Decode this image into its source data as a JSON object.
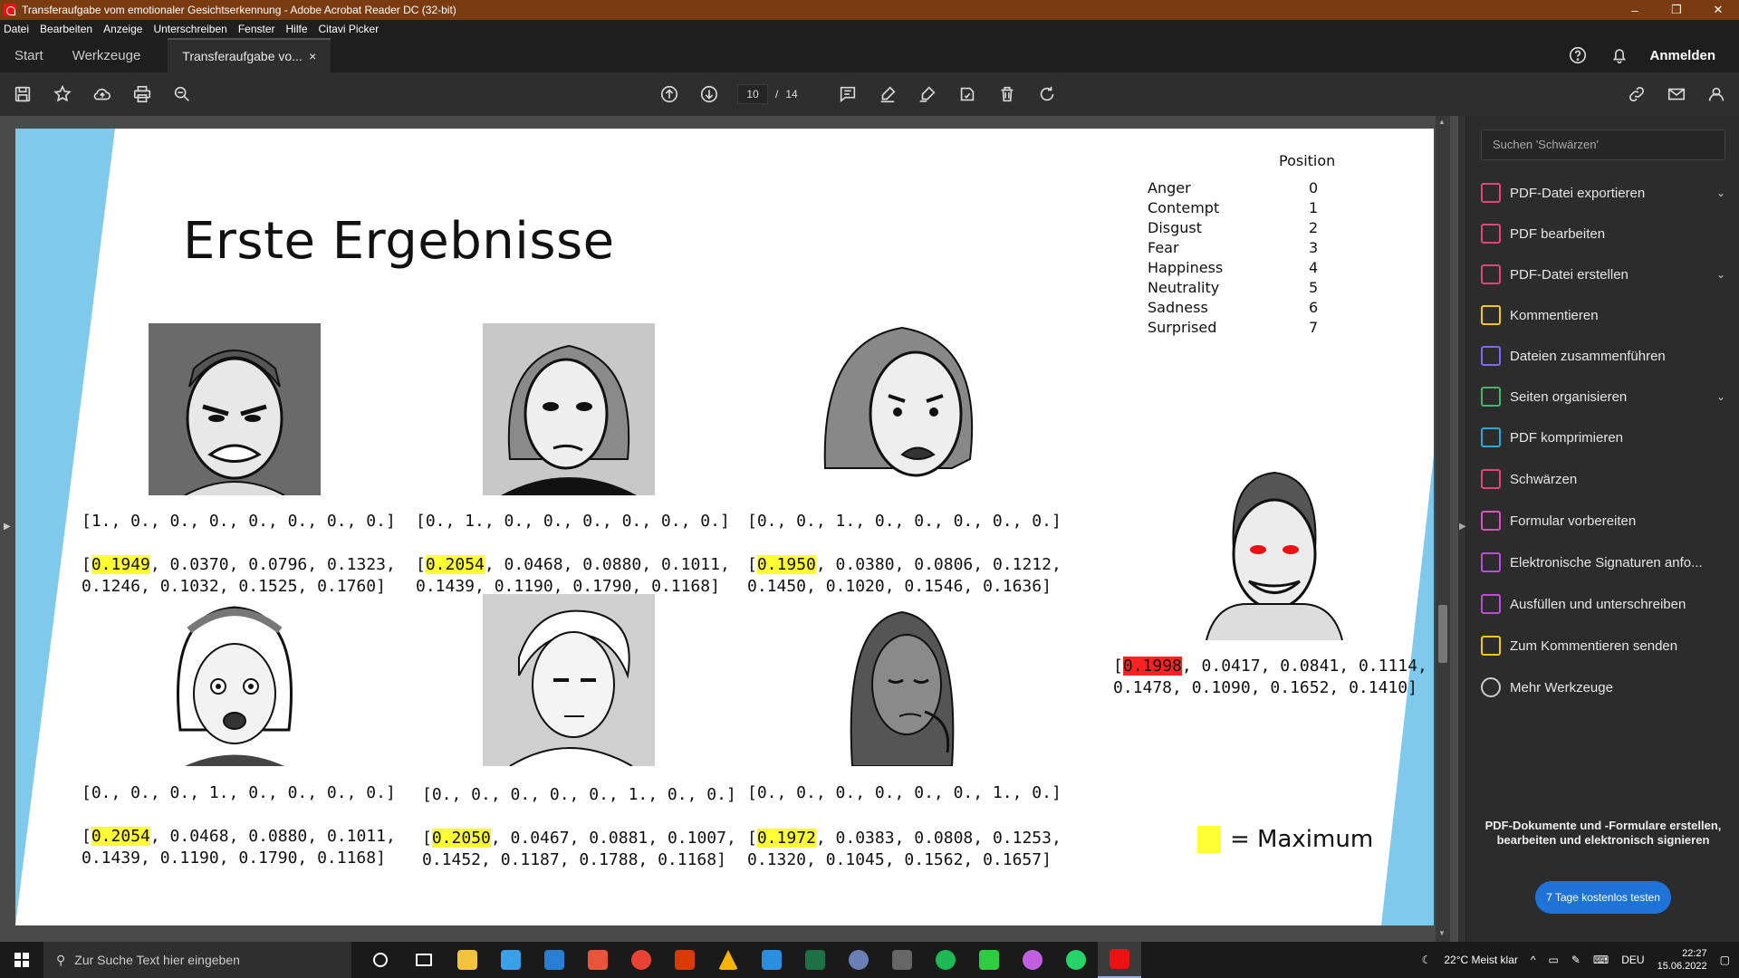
{
  "window": {
    "title": "Transferaufgabe vom emotionaler Gesichtserkennung - Adobe Acrobat Reader DC (32-bit)",
    "controls": [
      "–",
      "❐",
      "✕"
    ]
  },
  "menu": [
    "Datei",
    "Bearbeiten",
    "Anzeige",
    "Unterschreiben",
    "Fenster",
    "Hilfe",
    "Citavi Picker"
  ],
  "tabs": {
    "start": "Start",
    "tools": "Werkzeuge",
    "document": "Transferaufgabe vo...",
    "close": "×",
    "signin": "Anmelden"
  },
  "toolbar": {
    "current_page": "10",
    "separator": "/",
    "total_pages": "14"
  },
  "slide": {
    "title": "Erste Ergebnisse",
    "legend_header": "Position",
    "legend": [
      {
        "emotion": "Anger",
        "position": "0"
      },
      {
        "emotion": "Contempt",
        "position": "1"
      },
      {
        "emotion": "Disgust",
        "position": "2"
      },
      {
        "emotion": "Fear",
        "position": "3"
      },
      {
        "emotion": "Happiness",
        "position": "4"
      },
      {
        "emotion": "Neutrality",
        "position": "5"
      },
      {
        "emotion": "Sadness",
        "position": "6"
      },
      {
        "emotion": "Surprised",
        "position": "7"
      }
    ],
    "results": [
      {
        "label": "[1., 0., 0., 0., 0., 0., 0., 0.]",
        "open": "[",
        "max": "0.1949",
        "rest1": ", 0.0370, 0.0796, 0.1323,",
        "rest2": "0.1246, 0.1032, 0.1525, 0.1760]"
      },
      {
        "label": "[0., 1., 0., 0., 0., 0., 0., 0.]",
        "open": "[",
        "max": "0.2054",
        "rest1": ", 0.0468, 0.0880, 0.1011,",
        "rest2": "0.1439, 0.1190, 0.1790, 0.1168]"
      },
      {
        "label": "[0., 0., 1., 0., 0., 0., 0., 0.]",
        "open": "[",
        "max": "0.1950",
        "rest1": ", 0.0380, 0.0806, 0.1212,",
        "rest2": "0.1450, 0.1020, 0.1546, 0.1636]"
      },
      {
        "label": "[0., 0., 0., 1., 0., 0., 0., 0.]",
        "open": "[",
        "max": "0.2054",
        "rest1": ", 0.0468, 0.0880, 0.1011,",
        "rest2": "0.1439, 0.1190, 0.1790, 0.1168]"
      },
      {
        "label": "[0., 0., 0., 0., 0., 1., 0., 0.]",
        "open": "[",
        "max": "0.2050",
        "rest1": ", 0.0467, 0.0881, 0.1007,",
        "rest2": "0.1452, 0.1187, 0.1788, 0.1168]"
      },
      {
        "label": "[0., 0., 0., 0., 0., 0., 1., 0.]",
        "open": "[",
        "max": "0.1972",
        "rest1": ", 0.0383, 0.0808, 0.1253,",
        "rest2": "0.1320, 0.1045, 0.1562, 0.1657]"
      },
      {
        "label": "",
        "open": "[",
        "max": "0.1998",
        "rest1": ", 0.0417, 0.0841, 0.1114,",
        "rest2": "0.1478, 0.1090, 0.1652, 0.1410]"
      }
    ],
    "max_legend": "= Maximum",
    "colors": {
      "highlight": "#ffff33",
      "highlight_red": "#ff2222",
      "accent_blue": "#7fc9ec"
    }
  },
  "panel": {
    "search_placeholder": "Suchen 'Schwärzen'",
    "tools": [
      {
        "label": "PDF-Datei exportieren",
        "color": "#e0457b",
        "chevron": "⌄"
      },
      {
        "label": "PDF bearbeiten",
        "color": "#e0457b",
        "chevron": ""
      },
      {
        "label": "PDF-Datei erstellen",
        "color": "#e0457b",
        "chevron": "⌄"
      },
      {
        "label": "Kommentieren",
        "color": "#f2c811",
        "chevron": ""
      },
      {
        "label": "Dateien zusammenführen",
        "color": "#7e6cf0",
        "chevron": ""
      },
      {
        "label": "Seiten organisieren",
        "color": "#3fb96b",
        "chevron": "⌄"
      },
      {
        "label": "PDF komprimieren",
        "color": "#2aa8d8",
        "chevron": ""
      },
      {
        "label": "Schwärzen",
        "color": "#e0457b",
        "chevron": ""
      },
      {
        "label": "Formular vorbereiten",
        "color": "#d94fc0",
        "chevron": ""
      },
      {
        "label": "Elektronische Signaturen anfo...",
        "color": "#b94fd9",
        "chevron": ""
      },
      {
        "label": "Ausfüllen und unterschreiben",
        "color": "#b94fd9",
        "chevron": ""
      },
      {
        "label": "Zum Kommentieren senden",
        "color": "#f2c811",
        "chevron": ""
      },
      {
        "label": "Mehr Werkzeuge",
        "color": "#cccccc",
        "chevron": ""
      }
    ],
    "promo": "PDF-Dokumente und -Formulare erstellen, bearbeiten und elektronisch signieren",
    "trial_button": "7 Tage kostenlos testen"
  },
  "taskbar": {
    "search_placeholder": "Zur Suche Text hier eingeben",
    "weather": "22°C  Meist klar",
    "language": "DEU",
    "time": "22:27",
    "date": "15.06.2022"
  }
}
